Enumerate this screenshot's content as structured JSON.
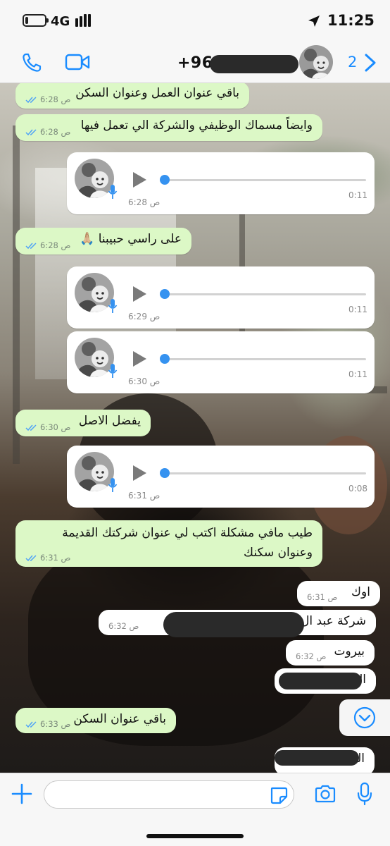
{
  "status_bar": {
    "network": "4G",
    "time": "11:25",
    "battery_level": 0.15,
    "icons": [
      "battery-icon",
      "signal-bars-icon",
      "location-arrow-icon"
    ]
  },
  "nav": {
    "contact_name": "+96",
    "unread_count": "2",
    "icons": [
      "phone-icon",
      "video-call-icon",
      "chevron-right-icon"
    ]
  },
  "messages": [
    {
      "type": "text",
      "side": "outgoing",
      "text": "باقي عنوان العمل وعنوان السكن",
      "time": "6:28 ص"
    },
    {
      "type": "text",
      "side": "outgoing",
      "text": "وايضاً مسماك الوظيفي والشركة الي تعمل فيها",
      "time": "6:28 ص"
    },
    {
      "type": "voice",
      "side": "incoming",
      "duration": "0:11",
      "time": "6:28 ص"
    },
    {
      "type": "text",
      "side": "outgoing",
      "text": "على راسي حبيبنا 🙏🏼",
      "time": "6:28 ص"
    },
    {
      "type": "voice",
      "side": "incoming",
      "duration": "0:11",
      "time": "6:29 ص"
    },
    {
      "type": "voice",
      "side": "incoming",
      "duration": "0:11",
      "time": "6:30 ص"
    },
    {
      "type": "text",
      "side": "outgoing",
      "text": "يفضل الاصل",
      "time": "6:30 ص"
    },
    {
      "type": "voice",
      "side": "incoming",
      "duration": "0:08",
      "time": "6:31 ص"
    },
    {
      "type": "text",
      "side": "outgoing",
      "text": "طيب مافي مشكلة اكتب لي عنوان شركتك القديمة وعنوان سكنك",
      "time": "6:31 ص"
    },
    {
      "type": "text",
      "side": "incoming",
      "text": "اوك",
      "time": "6:31 ص"
    },
    {
      "type": "text",
      "side": "incoming",
      "text": "شركة عبد ال",
      "time": "6:32 ص"
    },
    {
      "type": "text",
      "side": "incoming",
      "text": "بيروت",
      "time": "6:32 ص"
    },
    {
      "type": "text",
      "side": "incoming",
      "text": "ال"
    },
    {
      "type": "text",
      "side": "outgoing",
      "text": "باقي عنوان السكن",
      "time": "6:33 ص"
    },
    {
      "type": "text",
      "side": "incoming",
      "text": "الـ"
    }
  ],
  "input": {
    "placeholder": "",
    "icons": [
      "plus-icon",
      "sticker-icon",
      "camera-icon",
      "microphone-icon"
    ]
  },
  "scroll_button": {
    "icon": "chevron-down-circle-icon"
  },
  "colors": {
    "accent": "#1a8cff",
    "outgoing_bubble": "#dcf8c6",
    "incoming_bubble": "#ffffff",
    "read_ticks": "#4fa3f7",
    "voice_knob": "#3592f0"
  }
}
